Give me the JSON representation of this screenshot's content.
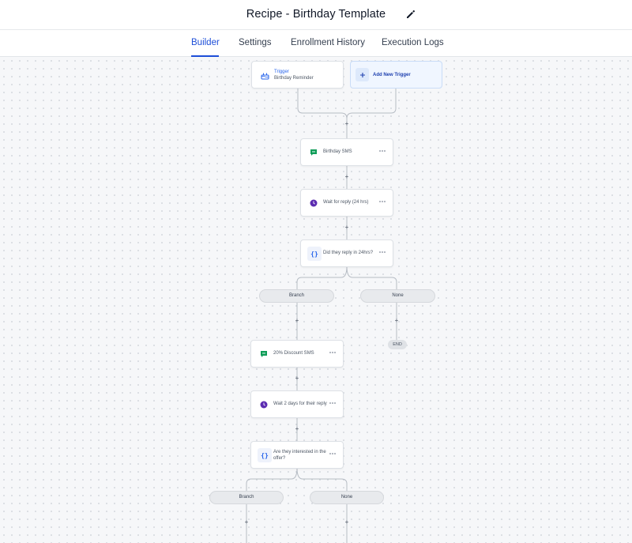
{
  "header": {
    "title": "Recipe - Birthday Template",
    "edit_icon": "pencil-icon"
  },
  "tabs": [
    {
      "label": "Builder",
      "active": true
    },
    {
      "label": "Settings",
      "active": false
    },
    {
      "label": "Enrollment History",
      "active": false
    },
    {
      "label": "Execution Logs",
      "active": false
    }
  ],
  "colors": {
    "accent": "#1d4ed8",
    "sms": "#0f9d58",
    "wait": "#5b2bb0",
    "condition": "#2563eb"
  },
  "workflow": {
    "trigger": {
      "kind": "Trigger",
      "name": "Birthday Reminder",
      "icon": "cake-icon"
    },
    "add_trigger": {
      "label": "Add New Trigger",
      "icon": "plus-icon"
    },
    "steps": [
      {
        "label": "Birthday SMS",
        "icon": "chat-bubble-icon"
      },
      {
        "label": "Wait for reply (24 hrs)",
        "icon": "clock-icon"
      },
      {
        "label": "Did they reply in 24hrs?",
        "icon": "braces-icon"
      }
    ],
    "branch1": {
      "left": "Branch",
      "right": "None",
      "end": "END"
    },
    "branch_steps": [
      {
        "label": "20% Discount SMS",
        "icon": "chat-bubble-icon"
      },
      {
        "label": "Wait 2 days for their reply",
        "icon": "clock-icon"
      },
      {
        "label": "Are they interested in the offer?",
        "icon": "braces-icon"
      }
    ],
    "branch2": {
      "left": "Branch",
      "right": "None"
    }
  }
}
